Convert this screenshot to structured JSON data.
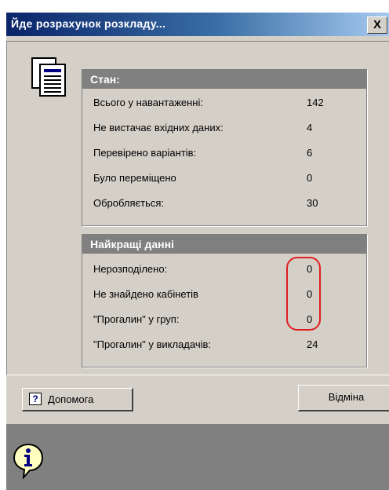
{
  "window": {
    "title": "Йде розрахунок розкладу...",
    "close_label": "X"
  },
  "status_panel": {
    "header": "Стан:",
    "rows": [
      {
        "label": "Всього у навантаженні:",
        "value": "142"
      },
      {
        "label": "Не вистачає вхідних даних:",
        "value": "4"
      },
      {
        "label": "Перевірено варіантів:",
        "value": "6"
      },
      {
        "label": "Було переміщено",
        "value": "0"
      },
      {
        "label": "Обробляється:",
        "value": "30"
      }
    ]
  },
  "best_panel": {
    "header": "Найкращі данні",
    "rows": [
      {
        "label": "Нерозподілено:",
        "value": "0"
      },
      {
        "label": "Не знайдено кабінетів",
        "value": "0"
      },
      {
        "label": "\"Прогалин\" у груп:",
        "value": "0"
      },
      {
        "label": "\"Прогалин\" у викладачів:",
        "value": "24"
      }
    ]
  },
  "buttons": {
    "help_icon": "?",
    "help_label": "Допомога",
    "cancel_label": "Відміна"
  },
  "colors": {
    "title_start": "#0a246a",
    "title_end": "#a6caf0",
    "face": "#d4d0c8",
    "panel_header": "#808080",
    "highlight_oval": "#e01e1e",
    "info_icon": "#ffffc0"
  },
  "icons": {
    "document": "document-icon",
    "info": "info-icon",
    "help": "help-icon",
    "close": "close-icon"
  }
}
